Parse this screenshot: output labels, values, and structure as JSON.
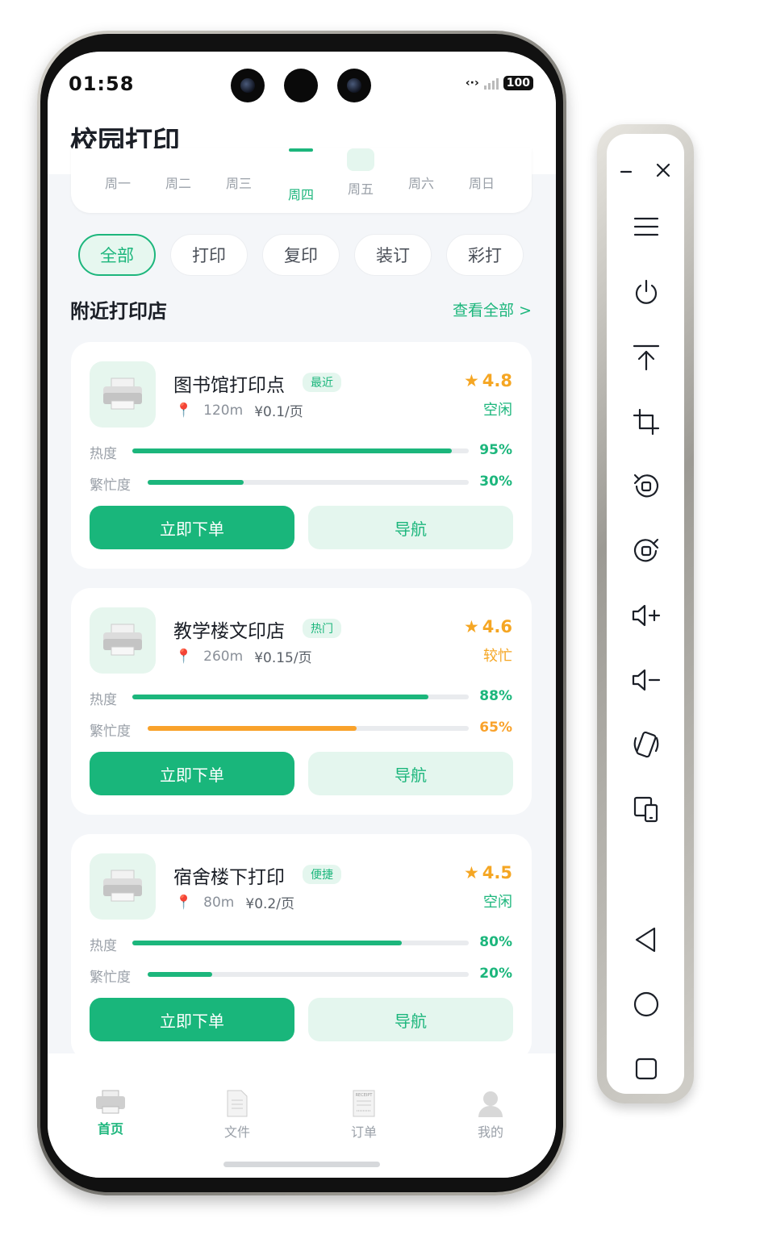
{
  "status_bar": {
    "time": "01:58",
    "battery": "100"
  },
  "app": {
    "title": "校园打印"
  },
  "week": {
    "days": [
      "周一",
      "周二",
      "周三",
      "周四",
      "周五",
      "周六",
      "周日"
    ],
    "selected": "周四"
  },
  "filters": [
    "全部",
    "打印",
    "复印",
    "装订",
    "彩打"
  ],
  "section": {
    "title": "附近打印店",
    "see_all": "查看全部 >"
  },
  "labels": {
    "heat": "热度",
    "busy": "繁忙度",
    "order": "立即下单",
    "navigate": "导航"
  },
  "shops": [
    {
      "name": "图书馆打印点",
      "tag": "最近",
      "distance": "120m",
      "price": "¥0.1/页",
      "rating": "4.8",
      "status": "空闲",
      "heat": "95%",
      "heat_value": 95,
      "busy": "30%",
      "busy_value": 30,
      "busy_color": "#1cb67c"
    },
    {
      "name": "教学楼文印店",
      "tag": "热门",
      "distance": "260m",
      "price": "¥0.15/页",
      "rating": "4.6",
      "status": "较忙",
      "heat": "88%",
      "heat_value": 88,
      "busy": "65%",
      "busy_value": 65,
      "busy_color": "#f9a22b"
    },
    {
      "name": "宿舍楼下打印",
      "tag": "便捷",
      "distance": "80m",
      "price": "¥0.2/页",
      "rating": "4.5",
      "status": "空闲",
      "heat": "80%",
      "heat_value": 80,
      "busy": "20%",
      "busy_value": 20,
      "busy_color": "#1cb67c"
    }
  ],
  "tabbar": {
    "items": [
      "首页",
      "文件",
      "订单",
      "我的"
    ],
    "active": "首页",
    "receipt_text": "RECEIPT"
  },
  "colors": {
    "accent": "#1cb67c",
    "warning": "#f9a22b",
    "star": "#f5a623"
  },
  "side_panel": {
    "icons": [
      "minimize-icon",
      "close-icon",
      "menu-icon",
      "power-icon",
      "to-top-icon",
      "crop-icon",
      "rotate-left-icon",
      "rotate-right-icon",
      "volume-up-icon",
      "volume-down-icon",
      "shake-icon",
      "device-switch-icon",
      "back-icon",
      "home-icon",
      "recents-icon"
    ]
  }
}
